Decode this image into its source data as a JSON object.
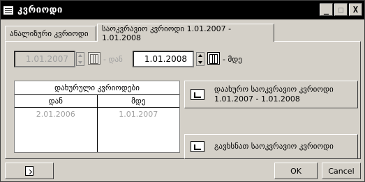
{
  "window": {
    "title": "კვრიოდი"
  },
  "titlebar_buttons": {
    "minimize": "_",
    "maximize": "□",
    "close": "X"
  },
  "tabs": [
    {
      "label": "ანალიზური კვრიოდი",
      "active": false
    },
    {
      "label": "საოკვრავიო კვრიოდი 1.01.2007 - 1.01.2008",
      "active": true
    }
  ],
  "period": {
    "from_value": "1.01.2007",
    "from_suffix": "- დან",
    "to_value": "1.01.2008",
    "to_suffix": "- მდე"
  },
  "closed_periods": {
    "title": "დახურული კვრიოდები",
    "columns": [
      "დან",
      "მდე"
    ],
    "rows": [
      [
        "2.01.2006",
        "1.01.2007"
      ]
    ]
  },
  "actions": {
    "close_period_line1": "დაახურო საოკვრავიო კვრიოდი",
    "close_period_line2": "1.01.2007 - 1.01.2008",
    "open_period": "გავხსნათ საოკვრავიო კვრიოდი"
  },
  "bottom": {
    "ok": "OK",
    "cancel": "Cancel"
  }
}
